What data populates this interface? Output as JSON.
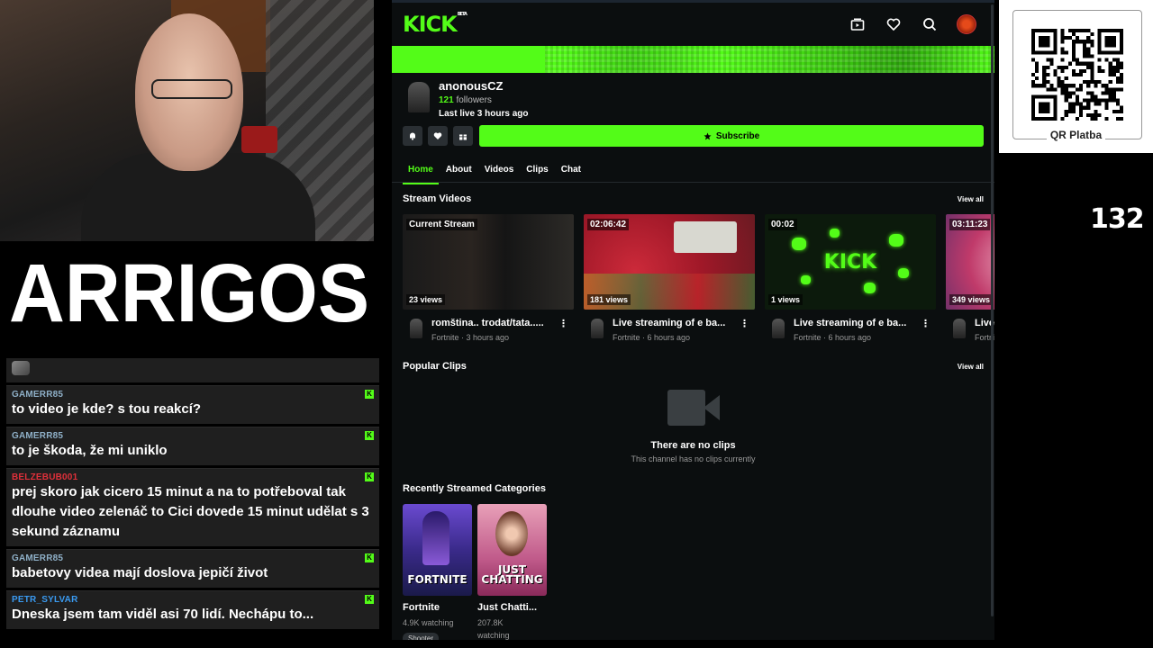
{
  "overlay": {
    "brand_logo_text": "ARRIGOS",
    "viewer_count": "132",
    "qr_label": "QR Platba"
  },
  "chat": [
    {
      "name": "GAMERR85",
      "name_color": "#8fb0c8",
      "text": "to video je kde? s tou reakcí?"
    },
    {
      "name": "GAMERR85",
      "name_color": "#8fb0c8",
      "text": "to je škoda, že mi uniklo"
    },
    {
      "name": "BELZEBUB001",
      "name_color": "#e0303a",
      "text": "prej skoro jak cicero 15 minut a na to potřeboval tak dlouhe video zelenáč to Cici dovede 15 minut udělat s 3 sekund záznamu"
    },
    {
      "name": "GAMERR85",
      "name_color": "#8fb0c8",
      "text": "babetovy videa mají doslova jepičí život"
    },
    {
      "name": "PETR_SYLVAR",
      "name_color": "#3a9af0",
      "text": "Dneska jsem tam viděl asi 70 lidí. Nechápu to..."
    }
  ],
  "browser": {
    "logo": "KICK",
    "beta": "BETA",
    "channel": {
      "name": "anonousCZ",
      "followers_count": "121",
      "followers_label": "followers",
      "last_live": "Last live 3 hours ago"
    },
    "subscribe_label": "Subscribe",
    "tabs": [
      "Home",
      "About",
      "Videos",
      "Clips",
      "Chat"
    ],
    "stream_videos": {
      "title": "Stream Videos",
      "view_all": "View all",
      "items": [
        {
          "badge": "Current Stream",
          "views": "23 views",
          "title": "romština.. trodat/tata.....",
          "category": "Fortnite",
          "age": "3 hours ago"
        },
        {
          "badge": "02:06:42",
          "views": "181 views",
          "title": "Live streaming of e ba...",
          "category": "Fortnite",
          "age": "6 hours ago"
        },
        {
          "badge": "00:02",
          "views": "1 views",
          "title": "Live streaming of e ba...",
          "category": "Fortnite",
          "age": "6 hours ago"
        },
        {
          "badge": "03:11:23",
          "views": "349 views",
          "title": "Live",
          "category": "Fortnite",
          "age": ""
        }
      ]
    },
    "popular_clips": {
      "title": "Popular Clips",
      "view_all": "View all",
      "empty_title": "There are no clips",
      "empty_sub": "This channel has no clips currently"
    },
    "categories": {
      "title": "Recently Streamed Categories",
      "items": [
        {
          "thumb_text": "FORTNITE",
          "name": "Fortnite",
          "watching": "4.9K watching",
          "tag": "Shooter"
        },
        {
          "thumb_text": "JUST CHATTING",
          "name": "Just Chatti...",
          "watching_num": "207.8K",
          "watching_label": "watching"
        }
      ]
    }
  },
  "colors": {
    "kick_green": "#53fc18",
    "browser_bg": "#0b0e0f"
  }
}
